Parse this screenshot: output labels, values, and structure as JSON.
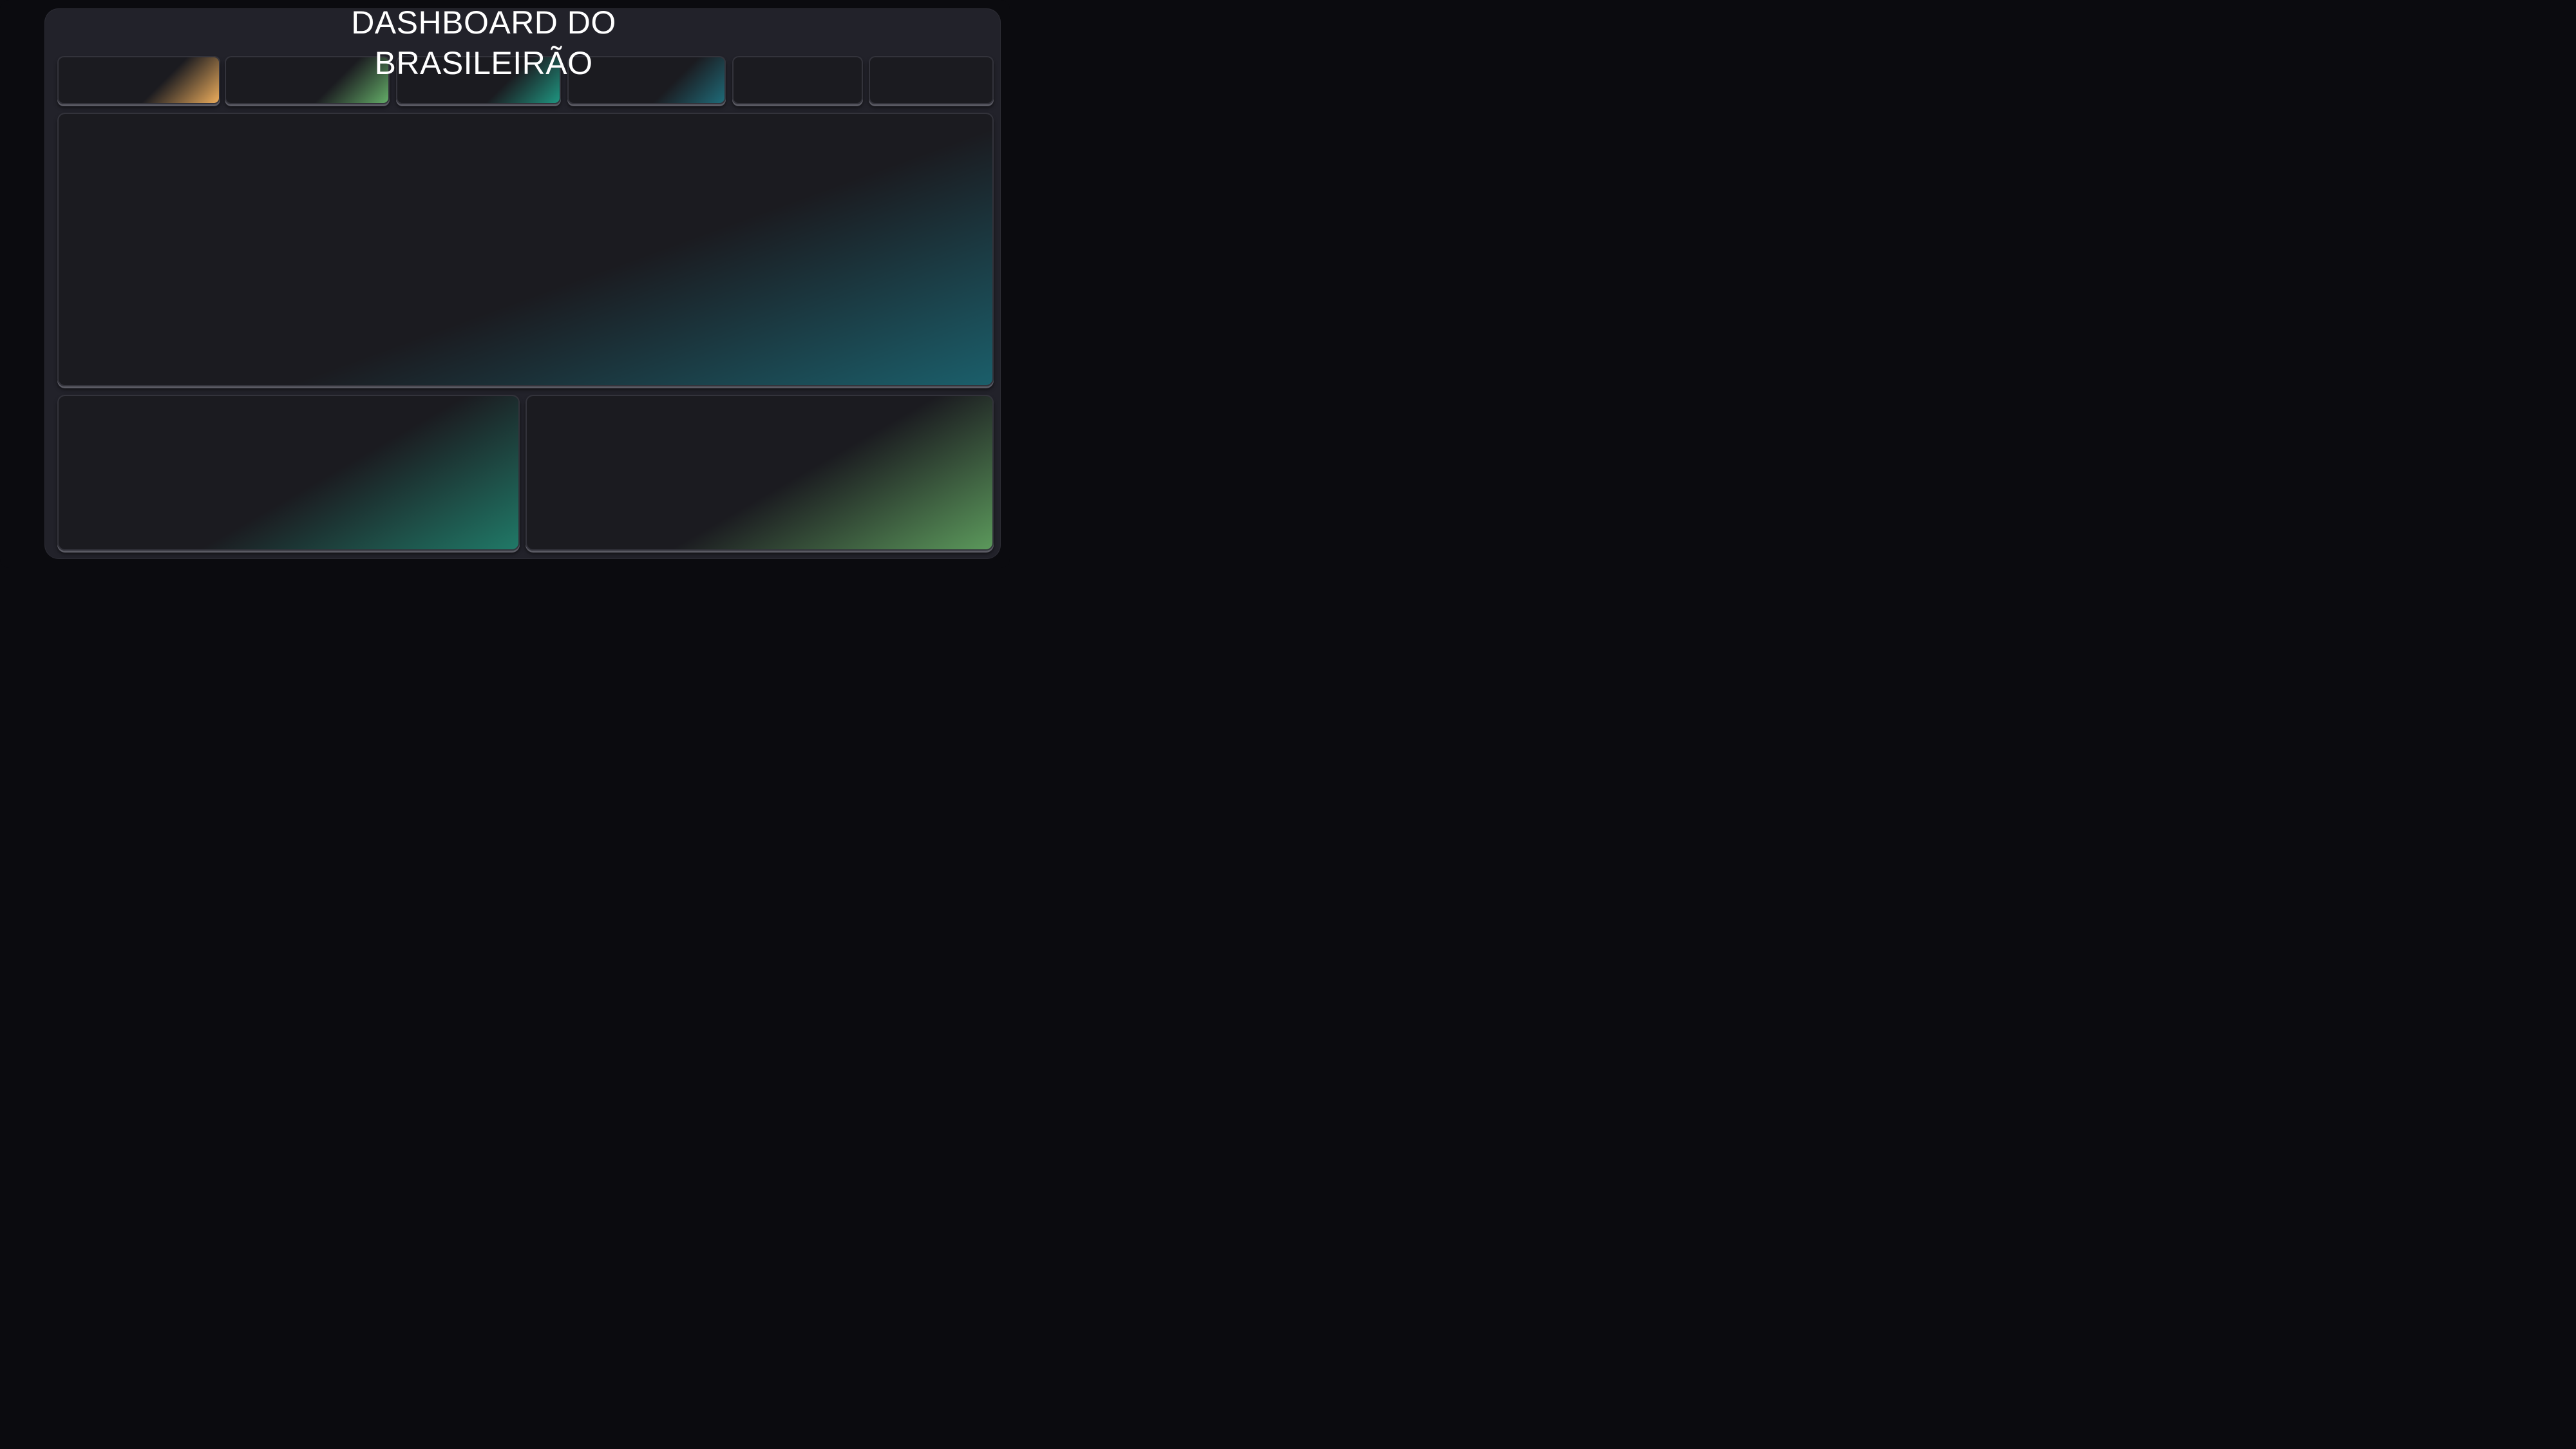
{
  "dashboard": {
    "title_line1": "DASHBOARD DO",
    "title_line2": "BRASILEIRÃO"
  },
  "colors": {
    "background": "#0b0b0f",
    "panel": "#22222a",
    "card": "#1b1b20",
    "accent_orange": "#f4b25e",
    "accent_green": "#66b26a",
    "accent_teal": "#1f9a84",
    "accent_blue_teal": "#1f6e7c"
  }
}
